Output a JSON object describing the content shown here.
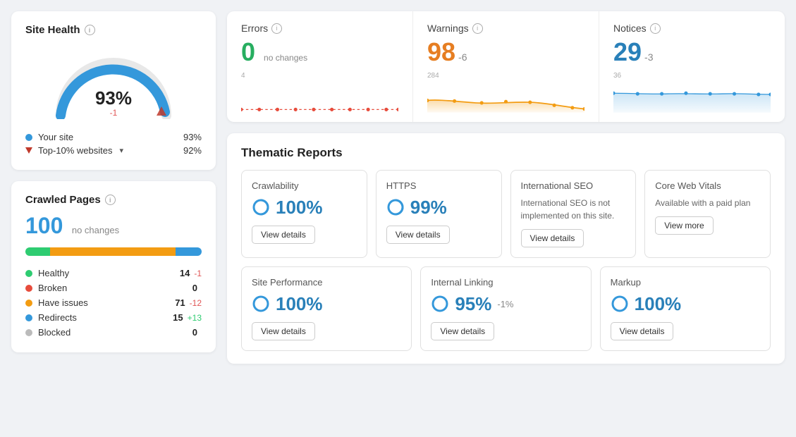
{
  "siteHealth": {
    "title": "Site Health",
    "percentage": "93%",
    "delta": "-1",
    "yourSiteLabel": "Your site",
    "yourSiteValue": "93%",
    "top10Label": "Top-10% websites",
    "top10Value": "92%",
    "gaugeColor": "#3498db",
    "gaugeBg": "#e8e8e8"
  },
  "crawledPages": {
    "title": "Crawled Pages",
    "count": "100",
    "noChangesText": "no changes",
    "stats": [
      {
        "label": "Healthy",
        "count": "14",
        "delta": "-1",
        "deltaType": "neg",
        "color": "#2ecc71"
      },
      {
        "label": "Broken",
        "count": "0",
        "delta": "",
        "deltaType": "",
        "color": "#e74c3c"
      },
      {
        "label": "Have issues",
        "count": "71",
        "delta": "-12",
        "deltaType": "neg",
        "color": "#f39c12"
      },
      {
        "label": "Redirects",
        "count": "15",
        "delta": "+13",
        "deltaType": "pos",
        "color": "#3498db"
      },
      {
        "label": "Blocked",
        "count": "0",
        "delta": "",
        "deltaType": "",
        "color": "#bbb"
      }
    ]
  },
  "metrics": [
    {
      "title": "Errors",
      "value": "0",
      "valueColor": "green",
      "subtext": "no changes",
      "delta": "",
      "deltaType": "",
      "chartType": "flat",
      "chartColor": "#e74c3c",
      "yTop": "4",
      "yBottom": "0"
    },
    {
      "title": "Warnings",
      "value": "98",
      "valueColor": "orange",
      "subtext": "",
      "delta": "-6",
      "deltaType": "neg",
      "chartType": "area",
      "chartColor": "#e67e22",
      "yTop": "284",
      "yBottom": "0"
    },
    {
      "title": "Notices",
      "value": "29",
      "valueColor": "blue",
      "subtext": "",
      "delta": "-3",
      "deltaType": "neg",
      "chartType": "area",
      "chartColor": "#3498db",
      "yTop": "36",
      "yBottom": "0"
    }
  ],
  "thematicReports": {
    "title": "Thematic Reports",
    "row1": [
      {
        "name": "Crawlability",
        "score": "100%",
        "delta": "",
        "hasScore": true,
        "btnLabel": "View details"
      },
      {
        "name": "HTTPS",
        "score": "99%",
        "delta": "",
        "hasScore": true,
        "btnLabel": "View details"
      },
      {
        "name": "International SEO",
        "score": "",
        "delta": "",
        "hasScore": false,
        "desc": "International SEO is not implemented on this site.",
        "btnLabel": "View details"
      },
      {
        "name": "Core Web Vitals",
        "score": "",
        "delta": "",
        "hasScore": false,
        "desc": "Available with a paid plan",
        "btnLabel": "View more"
      }
    ],
    "row2": [
      {
        "name": "Site Performance",
        "score": "100%",
        "delta": "",
        "hasScore": true,
        "btnLabel": "View details"
      },
      {
        "name": "Internal Linking",
        "score": "95%",
        "delta": "-1%",
        "hasScore": true,
        "btnLabel": "View details"
      },
      {
        "name": "Markup",
        "score": "100%",
        "delta": "",
        "hasScore": true,
        "btnLabel": "View details"
      }
    ]
  }
}
